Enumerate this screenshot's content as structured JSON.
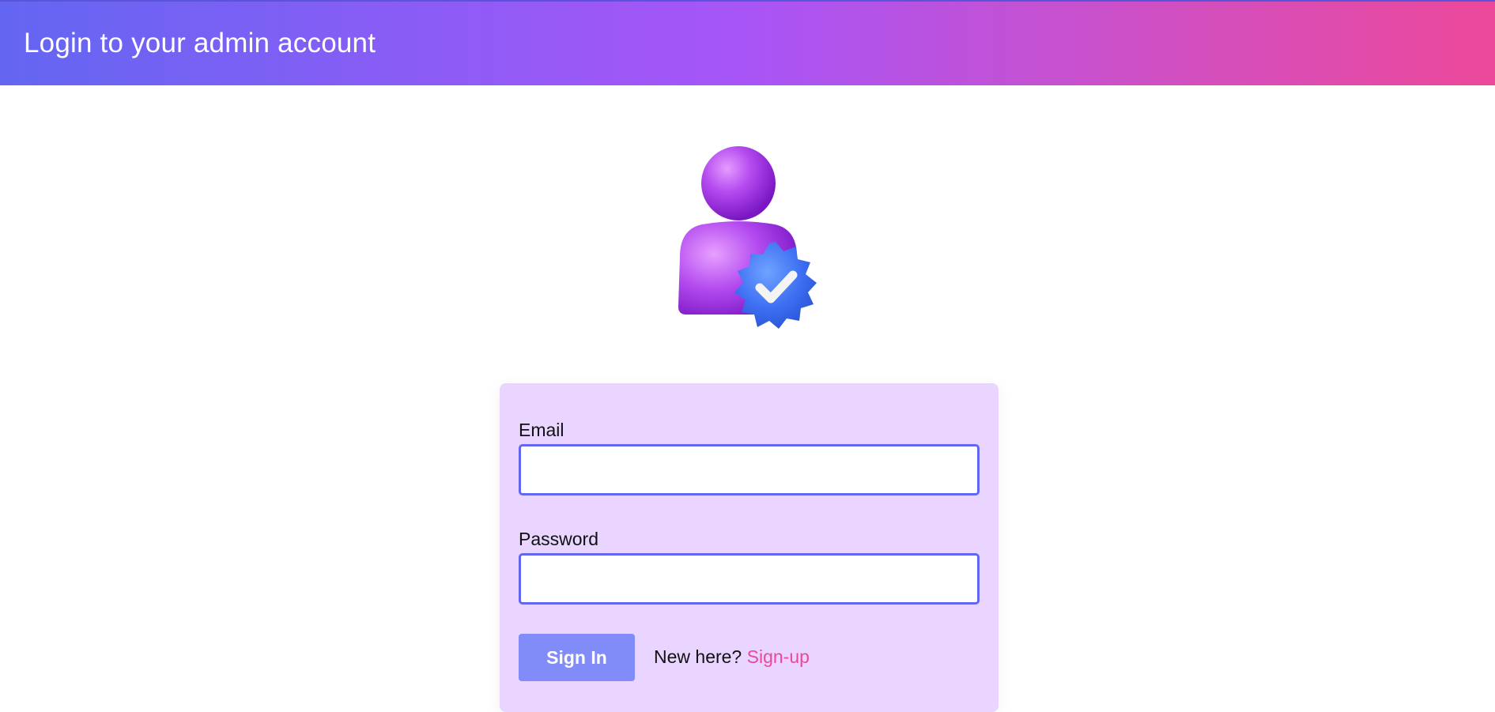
{
  "header": {
    "title": "Login to your admin account"
  },
  "avatar": {
    "icon": "verified-admin-user-icon"
  },
  "form": {
    "email_label": "Email",
    "email_value": "",
    "password_label": "Password",
    "password_value": "",
    "signin_label": "Sign In",
    "signup_prompt": "New here?",
    "signup_link": "Sign-up"
  },
  "colors": {
    "accent": "#6366f1",
    "button": "#818cf8",
    "card": "#e9d5ff",
    "link": "#ec4899",
    "gradient_start": "#6366f1",
    "gradient_mid": "#a855f7",
    "gradient_end": "#ec4899"
  }
}
